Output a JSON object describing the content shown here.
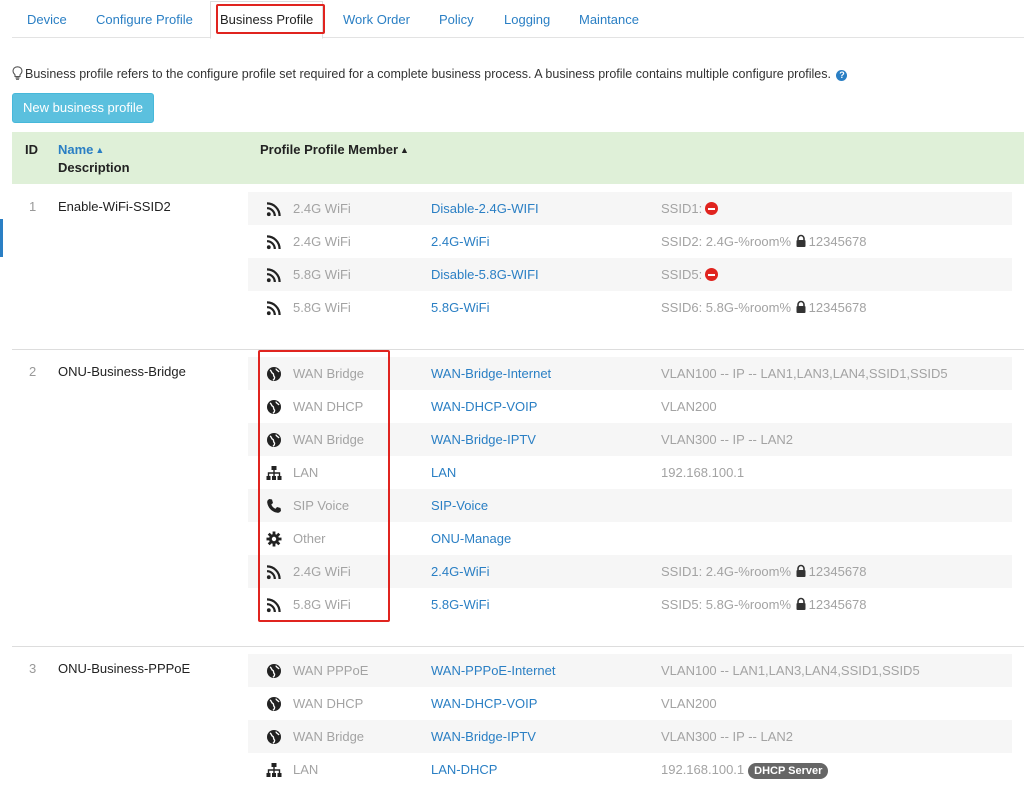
{
  "tabs": [
    {
      "label": "Device",
      "active": false
    },
    {
      "label": "Configure Profile",
      "active": false
    },
    {
      "label": "Business Profile",
      "active": true
    },
    {
      "label": "Work Order",
      "active": false
    },
    {
      "label": "Policy",
      "active": false
    },
    {
      "label": "Logging",
      "active": false
    },
    {
      "label": "Maintance",
      "active": false
    }
  ],
  "info": {
    "text": "Business profile refers to the configure profile set required for a complete business process. A business profile contains multiple configure profiles.",
    "icon": "lightbulb-icon",
    "help_icon": "question-circle-icon"
  },
  "new_button": {
    "label": "New business profile"
  },
  "table": {
    "headers": {
      "id": "ID",
      "name": "Name",
      "description": "Description",
      "profile": "Profile",
      "profile_member": "Profile Member"
    },
    "profiles": [
      {
        "id": "1",
        "name": "Enable-WiFi-SSID2",
        "members": [
          {
            "icon": "wifi-icon",
            "type": "2.4G WiFi",
            "name": "Disable-2.4G-WIFI",
            "detail": "SSID1:",
            "disabled_icon": true
          },
          {
            "icon": "wifi-icon",
            "type": "2.4G WiFi",
            "name": "2.4G-WiFi",
            "detail": "SSID2: 2.4G-%room%",
            "lock": true,
            "password": "12345678"
          },
          {
            "icon": "wifi-icon",
            "type": "5.8G WiFi",
            "name": "Disable-5.8G-WIFI",
            "detail": "SSID5:",
            "disabled_icon": true
          },
          {
            "icon": "wifi-icon",
            "type": "5.8G WiFi",
            "name": "5.8G-WiFi",
            "detail": "SSID6: 5.8G-%room%",
            "lock": true,
            "password": "12345678"
          }
        ]
      },
      {
        "id": "2",
        "name": "ONU-Business-Bridge",
        "members": [
          {
            "icon": "globe-icon",
            "type": "WAN Bridge",
            "name": "WAN-Bridge-Internet",
            "detail": "VLAN100 -- IP -- LAN1,LAN3,LAN4,SSID1,SSID5"
          },
          {
            "icon": "globe-icon",
            "type": "WAN DHCP",
            "name": "WAN-DHCP-VOIP",
            "detail": "VLAN200"
          },
          {
            "icon": "globe-icon",
            "type": "WAN Bridge",
            "name": "WAN-Bridge-IPTV",
            "detail": "VLAN300 -- IP -- LAN2"
          },
          {
            "icon": "sitemap-icon",
            "type": "LAN",
            "name": "LAN",
            "detail": "192.168.100.1"
          },
          {
            "icon": "phone-icon",
            "type": "SIP Voice",
            "name": "SIP-Voice",
            "detail": ""
          },
          {
            "icon": "gear-icon",
            "type": "Other",
            "name": "ONU-Manage",
            "detail": ""
          },
          {
            "icon": "wifi-icon",
            "type": "2.4G WiFi",
            "name": "2.4G-WiFi",
            "detail": "SSID1: 2.4G-%room%",
            "lock": true,
            "password": "12345678"
          },
          {
            "icon": "wifi-icon",
            "type": "5.8G WiFi",
            "name": "5.8G-WiFi",
            "detail": "SSID5: 5.8G-%room%",
            "lock": true,
            "password": "12345678"
          }
        ]
      },
      {
        "id": "3",
        "name": "ONU-Business-PPPoE",
        "members": [
          {
            "icon": "globe-icon",
            "type": "WAN PPPoE",
            "name": "WAN-PPPoE-Internet",
            "detail": "VLAN100 -- LAN1,LAN3,LAN4,SSID1,SSID5"
          },
          {
            "icon": "globe-icon",
            "type": "WAN DHCP",
            "name": "WAN-DHCP-VOIP",
            "detail": "VLAN200"
          },
          {
            "icon": "globe-icon",
            "type": "WAN Bridge",
            "name": "WAN-Bridge-IPTV",
            "detail": "VLAN300 -- IP -- LAN2"
          },
          {
            "icon": "sitemap-icon",
            "type": "LAN",
            "name": "LAN-DHCP",
            "detail": "192.168.100.1",
            "badge": "DHCP Server"
          }
        ]
      }
    ]
  },
  "colors": {
    "link": "#2a7fc4",
    "header_bg": "#dff0d8",
    "button_bg": "#5bc0de",
    "highlight": "#e0241f"
  }
}
